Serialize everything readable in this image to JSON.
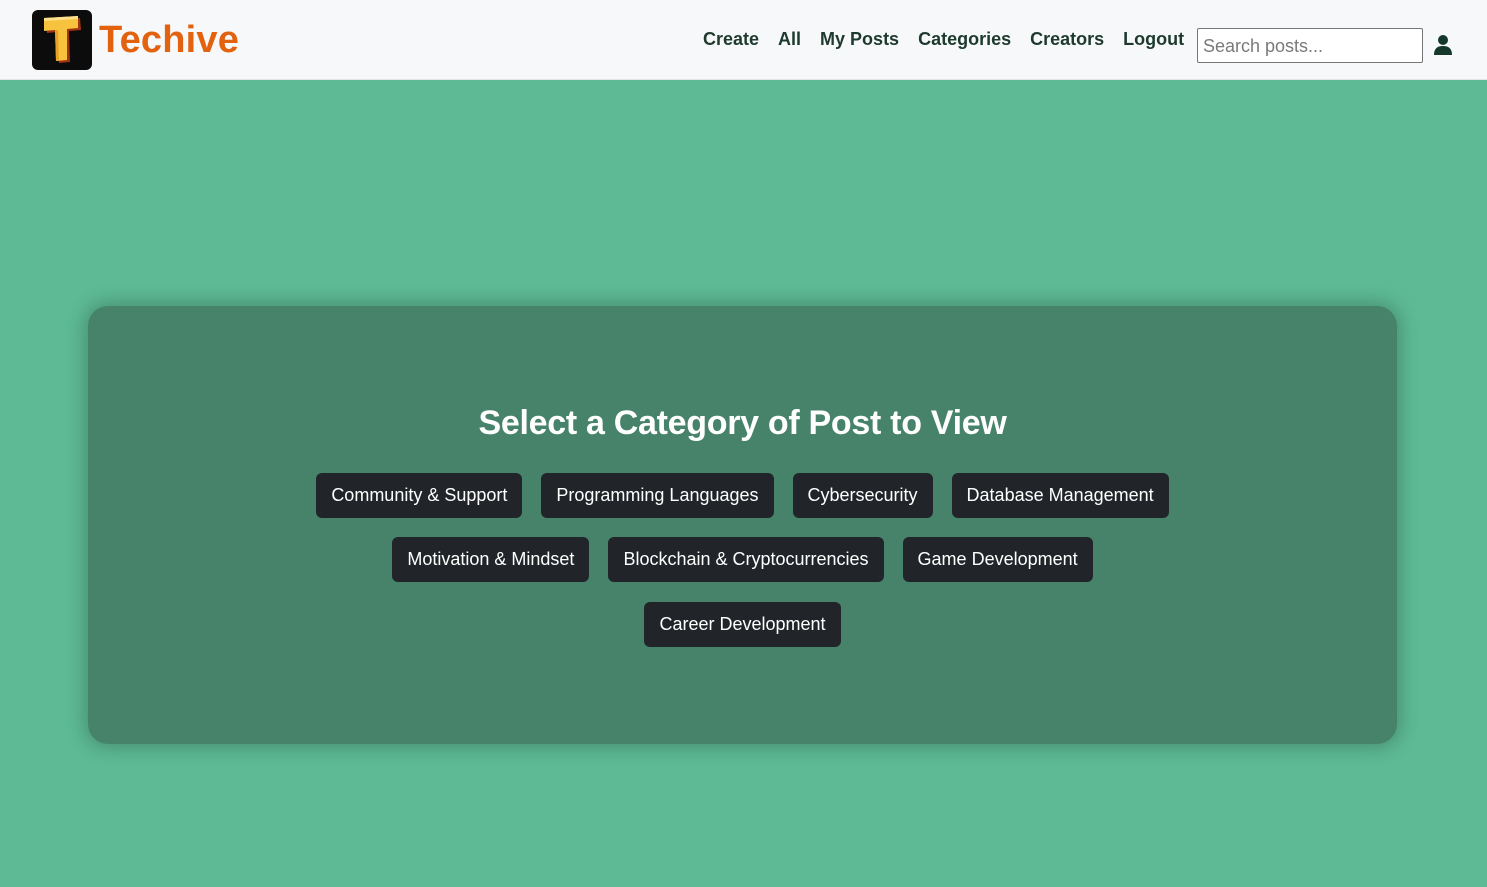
{
  "brand": {
    "logo_icon": "letter-t-logo",
    "name": "Techive",
    "color": "#e2620f"
  },
  "nav": {
    "links": [
      {
        "label": "Create"
      },
      {
        "label": "All"
      },
      {
        "label": "My Posts"
      },
      {
        "label": "Categories"
      },
      {
        "label": "Creators"
      },
      {
        "label": "Logout"
      }
    ],
    "search": {
      "placeholder": "Search posts...",
      "value": ""
    },
    "profile_icon": "user-icon"
  },
  "main": {
    "title": "Select a Category of Post to View",
    "categories": [
      {
        "label": "Community & Support"
      },
      {
        "label": "Programming Languages"
      },
      {
        "label": "Cybersecurity"
      },
      {
        "label": "Database Management"
      },
      {
        "label": "Motivation & Mindset"
      },
      {
        "label": "Blockchain & Cryptocurrencies"
      },
      {
        "label": "Game Development"
      },
      {
        "label": "Career Development"
      }
    ]
  },
  "colors": {
    "page_background": "#5dba94",
    "card_background": "#47836b",
    "button_background": "#212529",
    "nav_text": "#1d3a2d"
  }
}
